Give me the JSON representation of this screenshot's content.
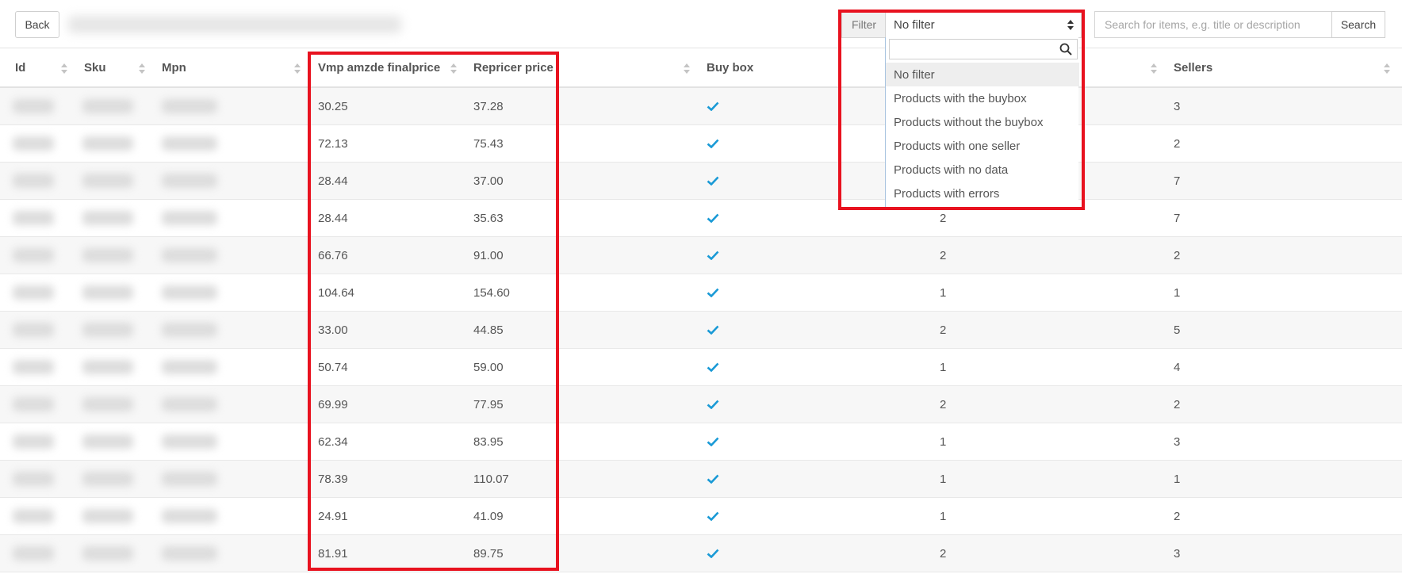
{
  "toolbar": {
    "back_label": "Back",
    "filter_label": "Filter",
    "filter_value": "No filter",
    "search_placeholder": "Search for items, e.g. title or description",
    "search_button": "Search"
  },
  "filter_dropdown": {
    "options": [
      "No filter",
      "Products with the buybox",
      "Products without the buybox",
      "Products with one seller",
      "Products with no data",
      "Products with errors"
    ],
    "selected_index": 0
  },
  "table": {
    "columns": [
      "Id",
      "Sku",
      "Mpn",
      "Vmp amzde finalprice",
      "Repricer price",
      "Buy box",
      "",
      "Sellers"
    ],
    "rows": [
      {
        "vmp": "30.25",
        "repricer": "37.28",
        "buybox": true,
        "count": "",
        "sellers": "3"
      },
      {
        "vmp": "72.13",
        "repricer": "75.43",
        "buybox": true,
        "count": "",
        "sellers": "2"
      },
      {
        "vmp": "28.44",
        "repricer": "37.00",
        "buybox": true,
        "count": "",
        "sellers": "7"
      },
      {
        "vmp": "28.44",
        "repricer": "35.63",
        "buybox": true,
        "count": "2",
        "sellers": "7"
      },
      {
        "vmp": "66.76",
        "repricer": "91.00",
        "buybox": true,
        "count": "2",
        "sellers": "2"
      },
      {
        "vmp": "104.64",
        "repricer": "154.60",
        "buybox": true,
        "count": "1",
        "sellers": "1"
      },
      {
        "vmp": "33.00",
        "repricer": "44.85",
        "buybox": true,
        "count": "2",
        "sellers": "5"
      },
      {
        "vmp": "50.74",
        "repricer": "59.00",
        "buybox": true,
        "count": "1",
        "sellers": "4"
      },
      {
        "vmp": "69.99",
        "repricer": "77.95",
        "buybox": true,
        "count": "2",
        "sellers": "2"
      },
      {
        "vmp": "62.34",
        "repricer": "83.95",
        "buybox": true,
        "count": "1",
        "sellers": "3"
      },
      {
        "vmp": "78.39",
        "repricer": "110.07",
        "buybox": true,
        "count": "1",
        "sellers": "1"
      },
      {
        "vmp": "24.91",
        "repricer": "41.09",
        "buybox": true,
        "count": "1",
        "sellers": "2"
      },
      {
        "vmp": "81.91",
        "repricer": "89.75",
        "buybox": true,
        "count": "2",
        "sellers": "3"
      }
    ]
  },
  "colors": {
    "highlight": "#e8121f",
    "check": "#1a9ad6",
    "row_stripe": "#f7f7f7"
  },
  "icons": {
    "check": "check-icon",
    "sort": "sort-icon",
    "search": "search-icon"
  }
}
